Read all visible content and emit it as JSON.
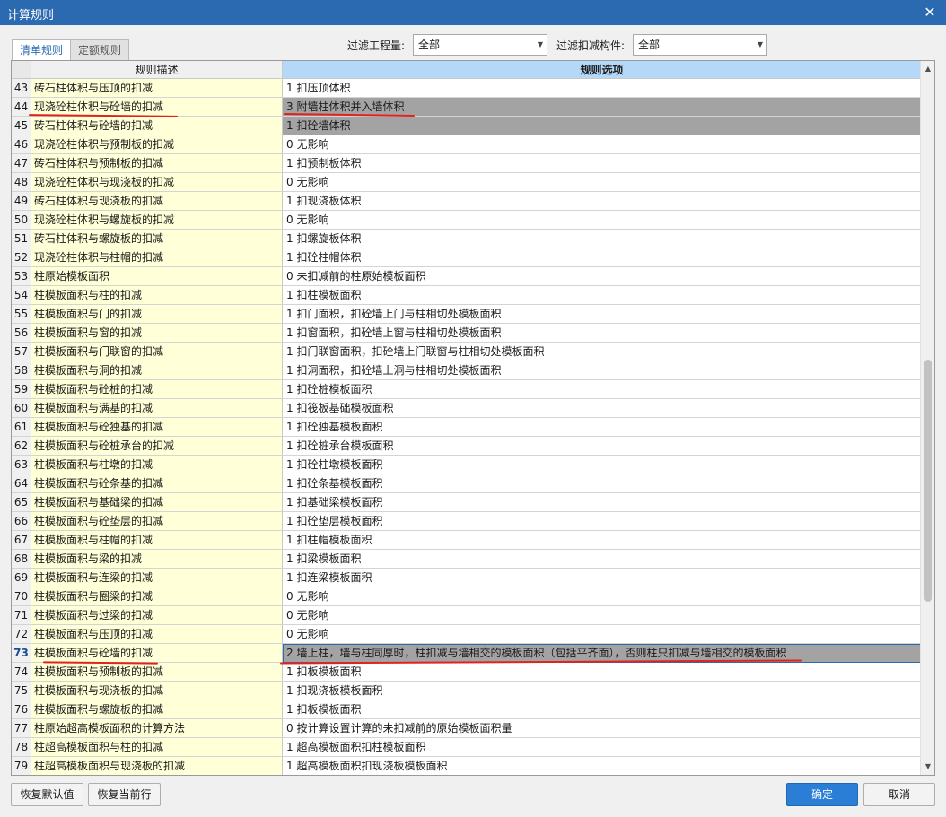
{
  "window": {
    "title": "计算规则",
    "close_glyph": "✕"
  },
  "tabs": [
    {
      "label": "清单规则",
      "active": true
    },
    {
      "label": "定额规则",
      "active": false
    }
  ],
  "filters": {
    "quantity_label": "过滤工程量:",
    "quantity_value": "全部",
    "component_label": "过滤扣减构件:",
    "component_value": "全部"
  },
  "table": {
    "headers": {
      "description": "规则描述",
      "options": "规则选项"
    },
    "rows": [
      {
        "num": "43",
        "desc": "砖石柱体积与压顶的扣减",
        "opt": "1 扣压顶体积"
      },
      {
        "num": "44",
        "desc": "现浇砼柱体积与砼墙的扣减",
        "opt": "3 附墙柱体积并入墙体积",
        "state": "gray"
      },
      {
        "num": "45",
        "desc": "砖石柱体积与砼墙的扣减",
        "opt": "1 扣砼墙体积",
        "state": "gray"
      },
      {
        "num": "46",
        "desc": "现浇砼柱体积与预制板的扣减",
        "opt": "0  无影响"
      },
      {
        "num": "47",
        "desc": "砖石柱体积与预制板的扣减",
        "opt": "1 扣预制板体积"
      },
      {
        "num": "48",
        "desc": "现浇砼柱体积与现浇板的扣减",
        "opt": "0  无影响"
      },
      {
        "num": "49",
        "desc": "砖石柱体积与现浇板的扣减",
        "opt": "1 扣现浇板体积"
      },
      {
        "num": "50",
        "desc": "现浇砼柱体积与螺旋板的扣减",
        "opt": "0  无影响"
      },
      {
        "num": "51",
        "desc": "砖石柱体积与螺旋板的扣减",
        "opt": "1 扣螺旋板体积"
      },
      {
        "num": "52",
        "desc": "现浇砼柱体积与柱帽的扣减",
        "opt": "1 扣砼柱帽体积"
      },
      {
        "num": "53",
        "desc": "柱原始模板面积",
        "opt": "0 未扣减前的柱原始模板面积"
      },
      {
        "num": "54",
        "desc": "柱模板面积与柱的扣减",
        "opt": "1 扣柱模板面积"
      },
      {
        "num": "55",
        "desc": "柱模板面积与门的扣减",
        "opt": "1 扣门面积，扣砼墙上门与柱相切处模板面积"
      },
      {
        "num": "56",
        "desc": "柱模板面积与窗的扣减",
        "opt": "1 扣窗面积，扣砼墙上窗与柱相切处模板面积"
      },
      {
        "num": "57",
        "desc": "柱模板面积与门联窗的扣减",
        "opt": "1 扣门联窗面积，扣砼墙上门联窗与柱相切处模板面积"
      },
      {
        "num": "58",
        "desc": "柱模板面积与洞的扣减",
        "opt": "1 扣洞面积，扣砼墙上洞与柱相切处模板面积"
      },
      {
        "num": "59",
        "desc": "柱模板面积与砼桩的扣减",
        "opt": "1 扣砼桩模板面积"
      },
      {
        "num": "60",
        "desc": "柱模板面积与满基的扣减",
        "opt": "1 扣筏板基础模板面积"
      },
      {
        "num": "61",
        "desc": "柱模板面积与砼独基的扣减",
        "opt": "1 扣砼独基模板面积"
      },
      {
        "num": "62",
        "desc": "柱模板面积与砼桩承台的扣减",
        "opt": "1 扣砼桩承台模板面积"
      },
      {
        "num": "63",
        "desc": "柱模板面积与柱墩的扣减",
        "opt": "1 扣砼柱墩模板面积"
      },
      {
        "num": "64",
        "desc": "柱模板面积与砼条基的扣减",
        "opt": "1 扣砼条基模板面积"
      },
      {
        "num": "65",
        "desc": "柱模板面积与基础梁的扣减",
        "opt": "1 扣基础梁模板面积"
      },
      {
        "num": "66",
        "desc": "柱模板面积与砼垫层的扣减",
        "opt": "1 扣砼垫层模板面积"
      },
      {
        "num": "67",
        "desc": "柱模板面积与柱帽的扣减",
        "opt": "1 扣柱帽模板面积"
      },
      {
        "num": "68",
        "desc": "柱模板面积与梁的扣减",
        "opt": "1 扣梁模板面积"
      },
      {
        "num": "69",
        "desc": "柱模板面积与连梁的扣减",
        "opt": "1 扣连梁模板面积"
      },
      {
        "num": "70",
        "desc": "柱模板面积与圈梁的扣减",
        "opt": "0  无影响"
      },
      {
        "num": "71",
        "desc": "柱模板面积与过梁的扣减",
        "opt": "0  无影响"
      },
      {
        "num": "72",
        "desc": "柱模板面积与压顶的扣减",
        "opt": "0  无影响"
      },
      {
        "num": "73",
        "desc": "柱模板面积与砼墙的扣减",
        "opt": "2 墙上柱，墙与柱同厚时，柱扣减与墙相交的模板面积（包括平齐面），否则柱只扣减与墙相交的模板面积",
        "state": "current"
      },
      {
        "num": "74",
        "desc": "柱模板面积与预制板的扣减",
        "opt": "1 扣板模板面积"
      },
      {
        "num": "75",
        "desc": "柱模板面积与现浇板的扣减",
        "opt": "1 扣现浇板模板面积"
      },
      {
        "num": "76",
        "desc": "柱模板面积与螺旋板的扣减",
        "opt": "1 扣板模板面积"
      },
      {
        "num": "77",
        "desc": "柱原始超高模板面积的计算方法",
        "opt": "0 按计算设置计算的未扣减前的原始模板面积量"
      },
      {
        "num": "78",
        "desc": "柱超高模板面积与柱的扣减",
        "opt": "1 超高模板面积扣柱模板面积"
      },
      {
        "num": "79",
        "desc": "柱超高模板面积与现浇板的扣减",
        "opt": "1 超高模板面积扣现浇板模板面积"
      }
    ]
  },
  "buttons": {
    "restore_default": "恢复默认值",
    "restore_current": "恢复当前行",
    "ok": "确定",
    "cancel": "取消"
  },
  "colors": {
    "title_bar": "#2b6ab0",
    "desc_column": "#ffffd8",
    "options_header": "#b4d8f8",
    "selected_row": "#a3a3a3",
    "annotation_line": "#e0241d",
    "primary_button": "#2a7ed6"
  }
}
